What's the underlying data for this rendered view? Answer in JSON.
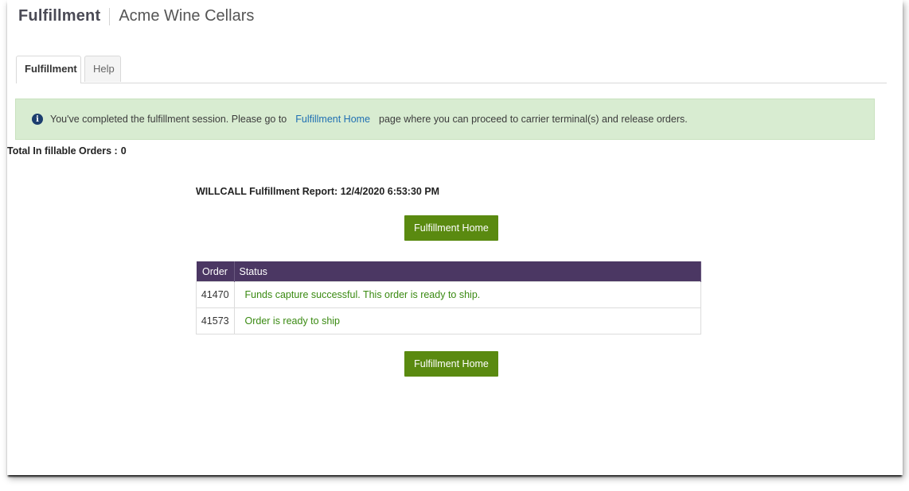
{
  "header": {
    "app_title": "Fulfillment",
    "org_name": "Acme Wine Cellars"
  },
  "tabs": [
    {
      "label": "Fulfillment",
      "active": true
    },
    {
      "label": "Help",
      "active": false
    }
  ],
  "notice": {
    "text_before": "You've completed the fulfillment session. Please go to",
    "link_label": "Fulfillment Home",
    "text_after": "page where you can proceed to carrier terminal(s) and release orders."
  },
  "summary": {
    "label": "Total In fillable Orders :",
    "count": "0"
  },
  "report": {
    "title": "WILLCALL Fulfillment Report: 12/4/2020 6:53:30 PM"
  },
  "buttons": {
    "home_label": "Fulfillment Home"
  },
  "orders_table": {
    "columns": [
      "Order",
      "Status"
    ],
    "rows": [
      {
        "order": "41470",
        "status": "Funds capture successful. This order is ready to ship."
      },
      {
        "order": "41573",
        "status": "Order is ready to ship"
      }
    ]
  },
  "colors": {
    "notice_bg": "#d8ecd1",
    "button_green": "#5a8a10",
    "table_header": "#4b3763",
    "status_green": "#3a8a12",
    "link_blue": "#1f6fb2"
  }
}
